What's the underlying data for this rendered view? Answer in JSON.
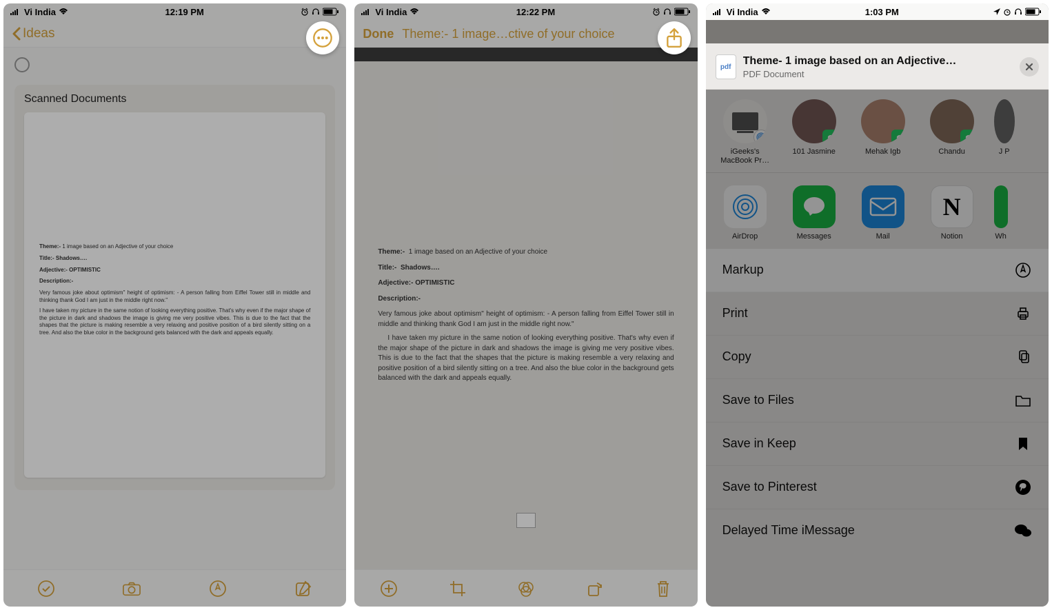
{
  "status": {
    "carrier": "Vi India",
    "time1": "12:19 PM",
    "time2": "12:22 PM",
    "time3": "1:03 PM"
  },
  "screen1": {
    "back_label": "Ideas",
    "card_title": "Scanned Documents",
    "doc": {
      "theme_label": "Theme:-",
      "theme_value": "1 image based on an Adjective of your choice",
      "title_label": "Title:-",
      "title_value": "Shadows….",
      "adj_label": "Adjective:-",
      "adj_value": "OPTIMISTIC",
      "desc_label": "Description:-",
      "para1": "Very famous joke about optimism\" height of optimism: - A person falling from Eiffel Tower still in middle and thinking thank God I am just in the middle right now.\"",
      "para2": "I have taken my picture in the same notion of looking everything positive. That's why even if the major shape of the picture in dark and shadows the image is giving me very positive vibes. This is due to the fact that the shapes that the picture is making resemble a very relaxing and positive position of a bird silently sitting on a tree.  And also the blue color in the background gets balanced with the dark and appeals equally."
    }
  },
  "screen2": {
    "done_label": "Done",
    "title": "Theme:- 1 image…ctive of your choice"
  },
  "screen3": {
    "share_title": "Theme- 1 image based on an Adjective…",
    "share_subtitle": "PDF Document",
    "pdf_badge": "pdf",
    "people": [
      {
        "name": "iGeeks's MacBook Pr…",
        "badge": "airdrop"
      },
      {
        "name": "101 Jasmine",
        "badge": "whatsapp"
      },
      {
        "name": "Mehak Igb",
        "badge": "whatsapp"
      },
      {
        "name": "Chandu",
        "badge": "whatsapp"
      },
      {
        "name": "J P",
        "badge": "whatsapp"
      }
    ],
    "apps": [
      {
        "name": "AirDrop"
      },
      {
        "name": "Messages"
      },
      {
        "name": "Mail"
      },
      {
        "name": "Notion"
      },
      {
        "name": "Wh"
      }
    ],
    "actions": {
      "markup": "Markup",
      "print": "Print",
      "copy": "Copy",
      "save_files": "Save to Files",
      "save_keep": "Save in Keep",
      "save_pinterest": "Save to Pinterest",
      "delayed": "Delayed Time iMessage"
    }
  }
}
